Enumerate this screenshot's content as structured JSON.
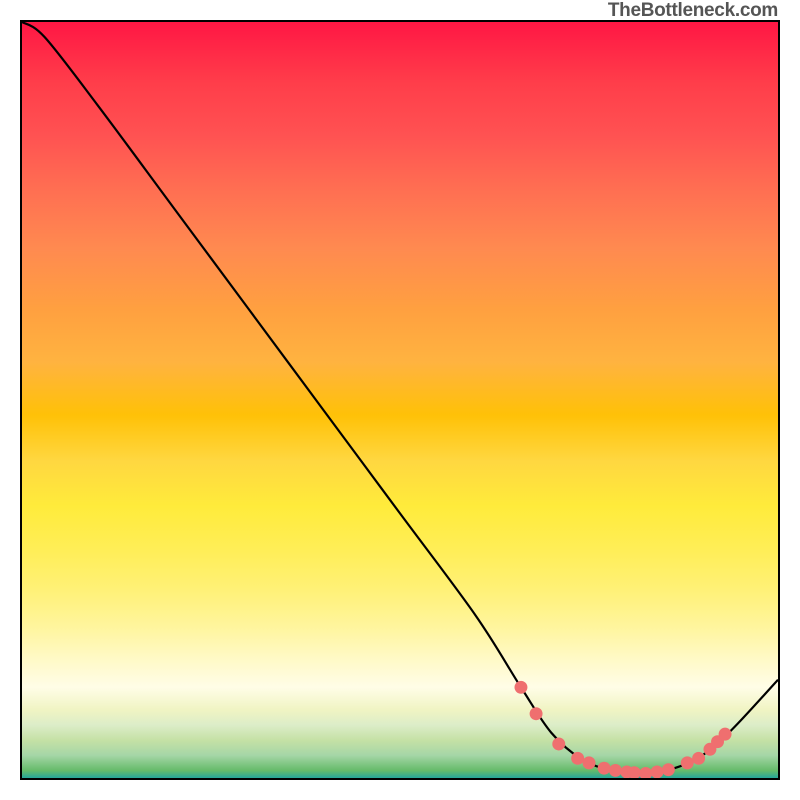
{
  "watermark": "TheBottleneck.com",
  "chart_data": {
    "type": "line",
    "title": "",
    "xlabel": "",
    "ylabel": "",
    "xlim": [
      0,
      100
    ],
    "ylim": [
      0,
      100
    ],
    "curve": [
      {
        "x": 0,
        "y": 100
      },
      {
        "x": 3,
        "y": 98
      },
      {
        "x": 10,
        "y": 89
      },
      {
        "x": 20,
        "y": 75.5
      },
      {
        "x": 30,
        "y": 62
      },
      {
        "x": 40,
        "y": 48.5
      },
      {
        "x": 50,
        "y": 35
      },
      {
        "x": 60,
        "y": 21.5
      },
      {
        "x": 66,
        "y": 12
      },
      {
        "x": 70,
        "y": 6
      },
      {
        "x": 74,
        "y": 2.5
      },
      {
        "x": 78,
        "y": 1
      },
      {
        "x": 82,
        "y": 0.6
      },
      {
        "x": 86,
        "y": 1.2
      },
      {
        "x": 90,
        "y": 3
      },
      {
        "x": 94,
        "y": 6.5
      },
      {
        "x": 100,
        "y": 13
      }
    ],
    "dots": [
      {
        "x": 66,
        "y": 12
      },
      {
        "x": 68,
        "y": 8.5
      },
      {
        "x": 71,
        "y": 4.5
      },
      {
        "x": 73.5,
        "y": 2.6
      },
      {
        "x": 75,
        "y": 2
      },
      {
        "x": 77,
        "y": 1.3
      },
      {
        "x": 78.5,
        "y": 1
      },
      {
        "x": 80,
        "y": 0.8
      },
      {
        "x": 81,
        "y": 0.7
      },
      {
        "x": 82.5,
        "y": 0.6
      },
      {
        "x": 84,
        "y": 0.8
      },
      {
        "x": 85.5,
        "y": 1.1
      },
      {
        "x": 88,
        "y": 2
      },
      {
        "x": 89.5,
        "y": 2.6
      },
      {
        "x": 91,
        "y": 3.8
      },
      {
        "x": 92,
        "y": 4.8
      },
      {
        "x": 93,
        "y": 5.8
      }
    ],
    "gradient_stops": [
      {
        "pos": 0,
        "color": "#ff1744"
      },
      {
        "pos": 50,
        "color": "#ffc107"
      },
      {
        "pos": 70,
        "color": "#ffeb3b"
      },
      {
        "pos": 95,
        "color": "#a5d6a7"
      },
      {
        "pos": 100,
        "color": "#26a69a"
      }
    ]
  }
}
